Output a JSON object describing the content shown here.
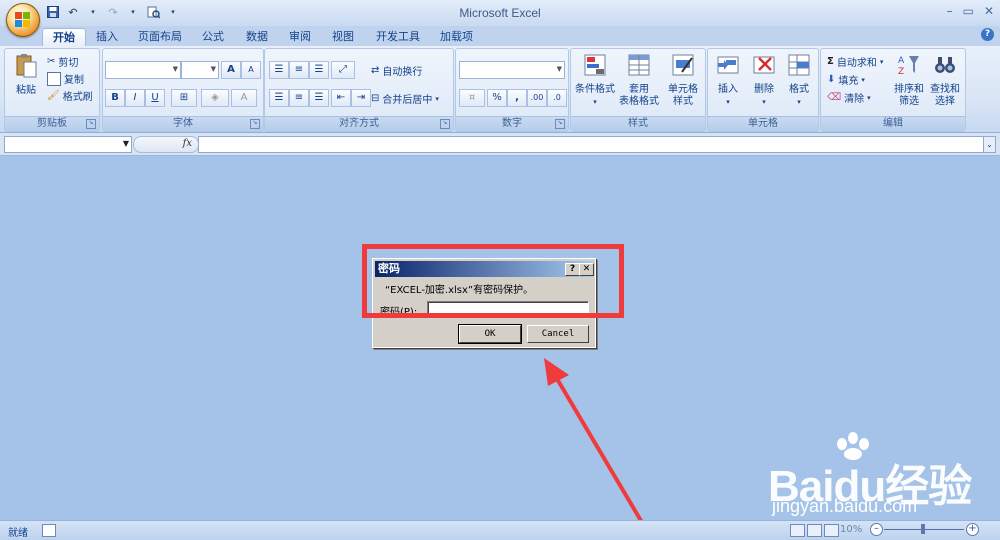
{
  "app": {
    "title": "Microsoft Excel"
  },
  "tabs": [
    "开始",
    "插入",
    "页面布局",
    "公式",
    "数据",
    "审阅",
    "视图",
    "开发工具",
    "加载项"
  ],
  "ribbon": {
    "clipboard": {
      "paste": "粘贴",
      "cut": "剪切",
      "copy": "复制",
      "format_painter": "格式刷",
      "label": "剪贴板"
    },
    "font": {
      "bold": "B",
      "italic": "I",
      "underline": "U",
      "grow": "A",
      "shrink": "A",
      "font_color": "A",
      "label": "字体"
    },
    "alignment": {
      "wrap": "自动换行",
      "merge": "合并后居中",
      "label": "对齐方式"
    },
    "number": {
      "percent": "%",
      "comma": ",",
      "inc_decimal": ".00",
      "dec_decimal": ".0",
      "label": "数字"
    },
    "styles": {
      "conditional": "条件格式",
      "table_1": "套用",
      "table_2": "表格格式",
      "cell_1": "单元格",
      "cell_2": "样式",
      "label": "样式"
    },
    "cells": {
      "insert": "插入",
      "delete": "删除",
      "format": "格式",
      "label": "单元格"
    },
    "editing": {
      "autosum": "自动求和",
      "fill": "填充",
      "clear": "清除",
      "sort_1": "排序和",
      "sort_2": "筛选",
      "find_1": "查找和",
      "find_2": "选择",
      "label": "编辑"
    }
  },
  "formula_bar": {
    "fx": "fx",
    "value": ""
  },
  "dialog": {
    "title": "密码",
    "help": "?",
    "close": "✕",
    "message": "“EXCEL-加密.xlsx”有密码保护。",
    "password_label": "密码(P):",
    "password_value": "",
    "ok": "OK",
    "cancel": "Cancel"
  },
  "status": {
    "ready": "就绪",
    "zoom": "10%"
  },
  "watermark": {
    "brand": "Baidu经验",
    "url": "jingyan.baidu.com"
  },
  "colors": {
    "highlight": "#ef3b3b",
    "workspace": "#a5c3e9",
    "ribbon": "#dae6f6"
  }
}
